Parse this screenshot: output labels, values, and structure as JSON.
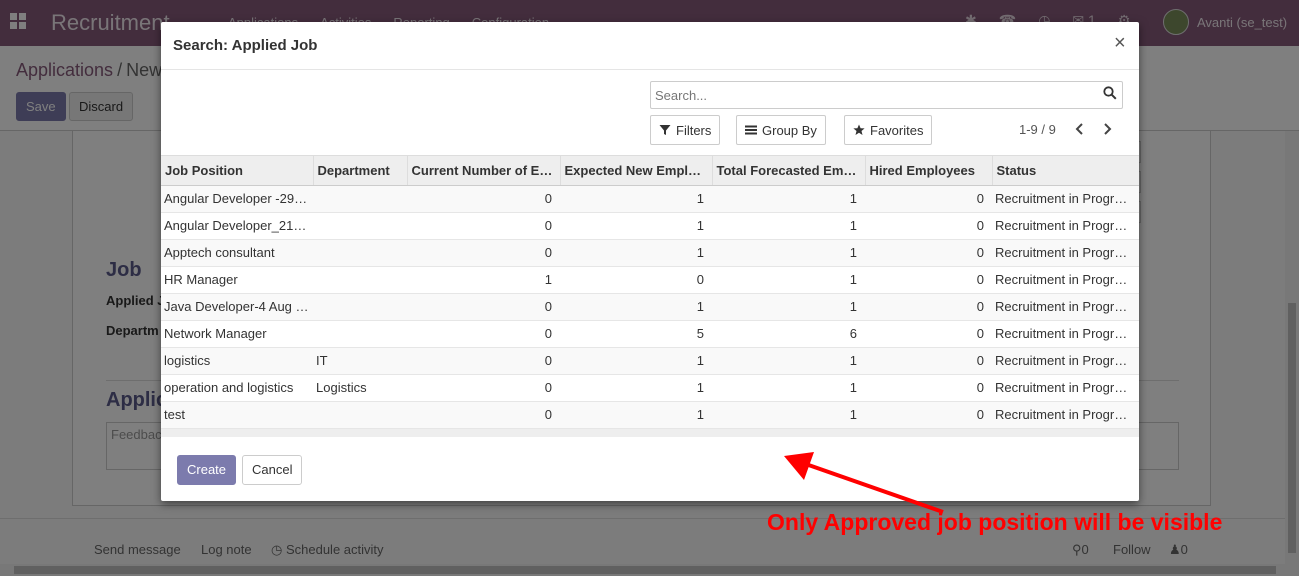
{
  "app": {
    "brand": "Recruitment",
    "menu": [
      "Applications",
      "Activities",
      "Reporting",
      "Configuration"
    ],
    "chat_count": "1",
    "user": "Avanti (se_test)"
  },
  "breadcrumb": {
    "parent": "Applications",
    "separator": "/",
    "current": "New"
  },
  "control": {
    "save_label": "Save",
    "discard_label": "Discard"
  },
  "form": {
    "job_heading": "Job",
    "applied_job_label": "Applied J",
    "department_label": "Departm",
    "application_heading": "Applic",
    "feedback_placeholder": "Feedbac"
  },
  "chatter": {
    "send_message": "Send message",
    "log_note": "Log note",
    "schedule_activity": "Schedule activity",
    "attachments_count": "0",
    "follow": "Follow",
    "followers_count": "0"
  },
  "modal": {
    "title": "Search: Applied Job",
    "close_symbol": "×",
    "search_placeholder": "Search...",
    "filters_label": "Filters",
    "groupby_label": "Group By",
    "favorites_label": "Favorites",
    "pager": "1-9 / 9",
    "columns": [
      "Job Position",
      "Department",
      "Current Number of E…",
      "Expected New Empl…",
      "Total Forecasted Em…",
      "Hired Employees",
      "Status"
    ],
    "rows": [
      [
        "Angular Developer -29…",
        "",
        "0",
        "1",
        "1",
        "0",
        "Recruitment in Progr…"
      ],
      [
        "Angular Developer_21…",
        "",
        "0",
        "1",
        "1",
        "0",
        "Recruitment in Progr…"
      ],
      [
        "Apptech consultant",
        "",
        "0",
        "1",
        "1",
        "0",
        "Recruitment in Progr…"
      ],
      [
        "HR Manager",
        "",
        "1",
        "0",
        "1",
        "0",
        "Recruitment in Progr…"
      ],
      [
        "Java Developer-4 Aug …",
        "",
        "0",
        "1",
        "1",
        "0",
        "Recruitment in Progr…"
      ],
      [
        "Network Manager",
        "",
        "0",
        "5",
        "6",
        "0",
        "Recruitment in Progr…"
      ],
      [
        "logistics",
        "IT",
        "0",
        "1",
        "1",
        "0",
        "Recruitment in Progr…"
      ],
      [
        "operation and logistics",
        "Logistics",
        "0",
        "1",
        "1",
        "0",
        "Recruitment in Progr…"
      ],
      [
        "test",
        "",
        "0",
        "1",
        "1",
        "0",
        "Recruitment in Progr…"
      ]
    ],
    "create_label": "Create",
    "cancel_label": "Cancel"
  },
  "annotation": {
    "text": "Only Approved job position will be visible",
    "color": "#ff0000"
  },
  "colors": {
    "brand": "#875a7b",
    "primary_button": "#7c7bad"
  }
}
